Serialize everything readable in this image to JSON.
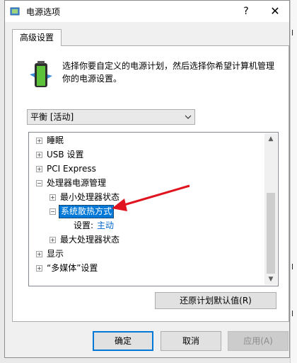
{
  "window": {
    "title": "电源选项",
    "help": "?",
    "close": "✕"
  },
  "tab": {
    "label": "高级设置"
  },
  "description": "选择你要自定义的电源计划，然后选择你希望计算机管理你的电源设置。",
  "plan_select": {
    "value": "平衡 [活动]"
  },
  "tree": {
    "items": [
      {
        "label": "睡眠",
        "expander": "+"
      },
      {
        "label": "USB 设置",
        "expander": "+"
      },
      {
        "label": "PCI Express",
        "expander": "+"
      },
      {
        "label": "处理器电源管理",
        "expander": "−"
      },
      {
        "label": "最小处理器状态",
        "expander": "+"
      },
      {
        "label": "系统散热方式",
        "expander": "−"
      },
      {
        "label": "设置:",
        "value": "主动"
      },
      {
        "label": "最大处理器状态",
        "expander": "+"
      },
      {
        "label": "显示",
        "expander": "+"
      },
      {
        "label": "“多媒体”设置",
        "expander": "+"
      }
    ]
  },
  "buttons": {
    "restore": "还原计划默认值(R)",
    "ok": "确定",
    "cancel": "取消",
    "apply": "应用(A)"
  },
  "behind_window": {
    "marks": [
      "l",
      "l",
      "l"
    ]
  },
  "colors": {
    "selection": "#0078d7",
    "annotation_arrow": "#e0141e",
    "setting_value": "#0066cc"
  }
}
